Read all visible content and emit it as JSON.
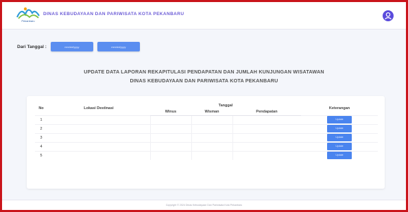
{
  "app": {
    "logo_text": "Pekanbaru",
    "title": "DINAS KEBUDAYAAN DAN PARIWISATA KOTA PEKANBARU"
  },
  "colors": {
    "accent": "#5a4bdc",
    "button": "#4a84ef",
    "border": "#c9141b"
  },
  "filter": {
    "label": "Dari Tanggal :",
    "start_date": "mm/dd/yyyy",
    "end_date": "mm/dd/yyyy"
  },
  "page": {
    "title_line1": "UPDATE DATA LAPORAN REKAPITULASI PENDAPATAN DAN JUMLAH KUNJUNGAN WISATAWAN",
    "title_line2": "DINAS KEBUDAYAAN DAN PARIWISATA KOTA PEKANBARU"
  },
  "table": {
    "headers": {
      "no": "No",
      "lokasi": "Lokasi Destinasi",
      "tanggal": "Tanggal",
      "winus": "Winus",
      "wisman": "Wisman",
      "pendapatan": "Pendapatan",
      "keterangan": "Keterangan"
    },
    "rows": [
      {
        "no": "1",
        "button": "Update"
      },
      {
        "no": "2",
        "button": "Update"
      },
      {
        "no": "3",
        "button": "Update"
      },
      {
        "no": "4",
        "button": "Update"
      },
      {
        "no": "5",
        "button": "Update"
      }
    ]
  },
  "footer": {
    "text": "Copyright © 2024 Dinas Kebudayaan Dan Pariwisata Kota Pekanbaru"
  }
}
